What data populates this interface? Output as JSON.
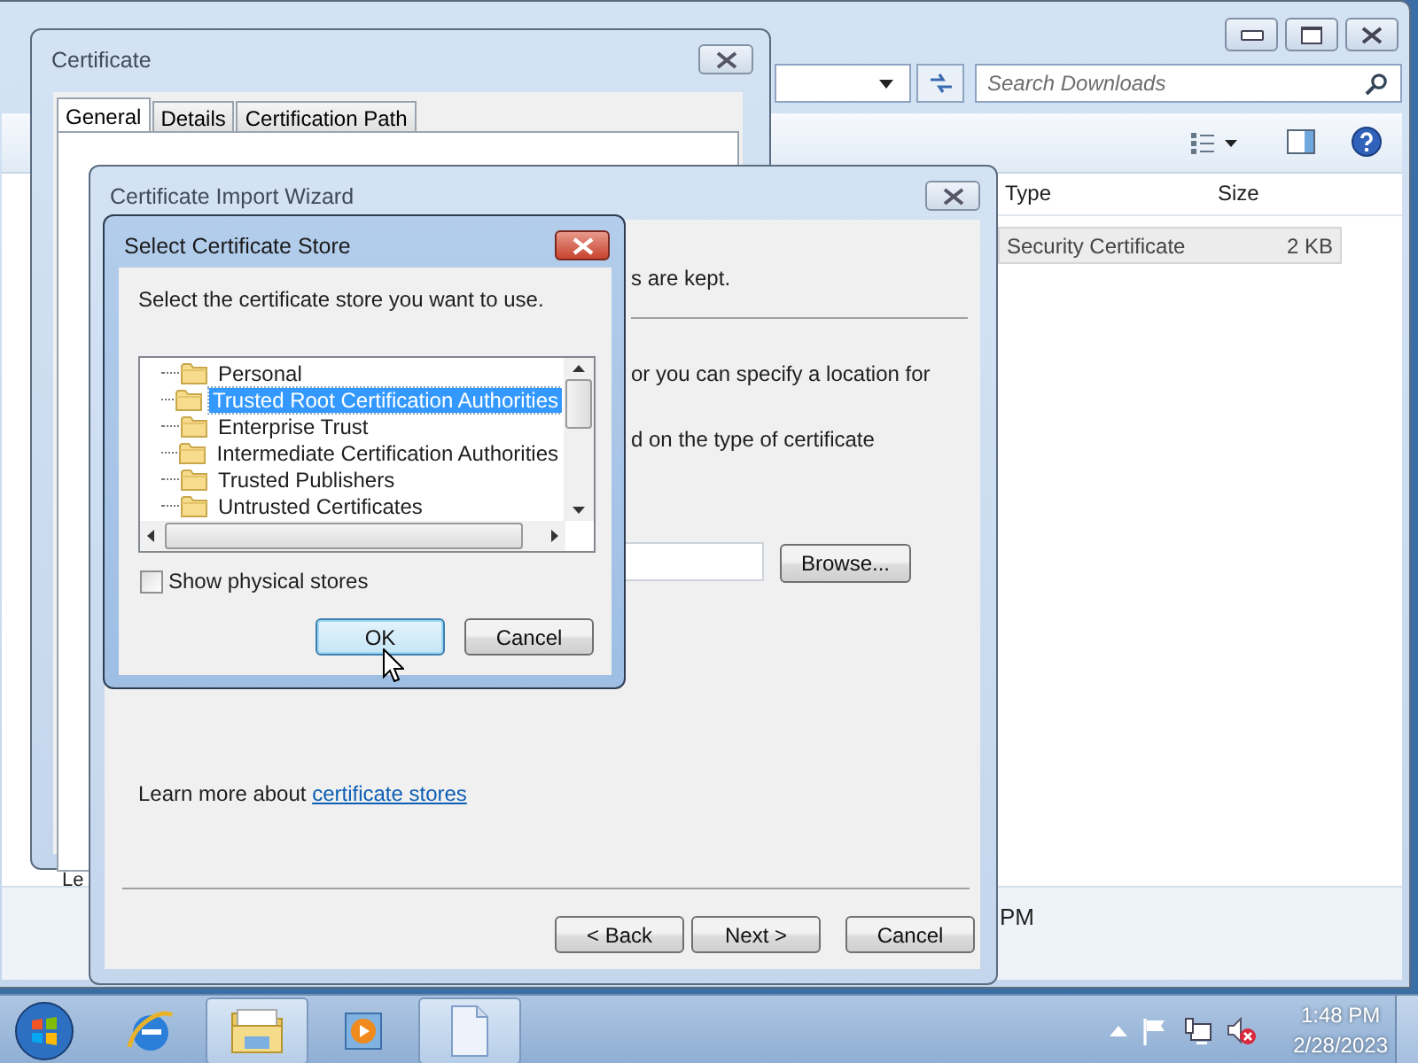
{
  "explorer": {
    "search": {
      "placeholder": "Search Downloads"
    },
    "columns": [
      "Type",
      "Size"
    ],
    "rows": [
      {
        "type": "Security Certificate",
        "size": "2 KB",
        "selected": true
      }
    ],
    "status_fragment": "PM"
  },
  "certificate": {
    "title": "Certificate",
    "tabs": [
      {
        "label": "General",
        "selected": true
      },
      {
        "label": "Details",
        "selected": false
      },
      {
        "label": "Certification Path",
        "selected": false
      }
    ],
    "fragment": "Le"
  },
  "wizard": {
    "title": "Certificate Import Wizard",
    "fragments": [
      "s are kept.",
      "or you can specify a location for",
      "d on the type of certificate"
    ],
    "browse": "Browse...",
    "learn_more": "Learn more about",
    "link": "certificate stores",
    "buttons": [
      "< Back",
      "Next >",
      "Cancel"
    ]
  },
  "store_dialog": {
    "title": "Select Certificate Store",
    "prompt": "Select the certificate store you want to use.",
    "stores": [
      {
        "label": "Personal",
        "selected": false
      },
      {
        "label": "Trusted Root Certification Authorities",
        "selected": true
      },
      {
        "label": "Enterprise Trust",
        "selected": false
      },
      {
        "label": "Intermediate Certification Authorities",
        "selected": false
      },
      {
        "label": "Trusted Publishers",
        "selected": false
      },
      {
        "label": "Untrusted Certificates",
        "selected": false
      }
    ],
    "show_physical": {
      "label": "Show physical stores",
      "checked": false
    },
    "buttons": [
      {
        "label": "OK",
        "default": true
      },
      {
        "label": "Cancel",
        "default": false
      }
    ]
  },
  "taskbar": {
    "items": [
      {
        "kind": "start",
        "selected": false
      },
      {
        "kind": "browser",
        "selected": false
      },
      {
        "kind": "folder",
        "selected": true
      },
      {
        "kind": "player",
        "selected": false
      },
      {
        "kind": "document",
        "selected": true
      }
    ],
    "time": "1:48 PM",
    "date": "2/28/2023"
  }
}
